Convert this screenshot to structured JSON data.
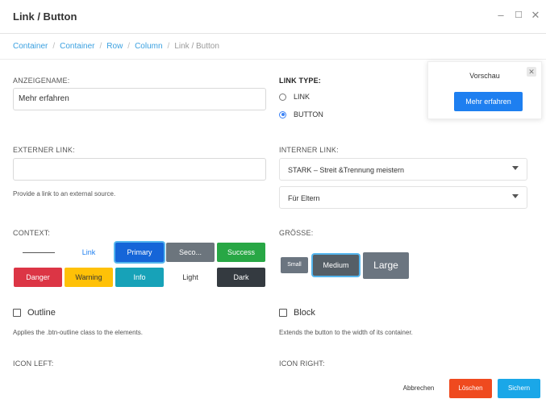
{
  "window": {
    "title": "Link / Button",
    "minimize": "–",
    "maximize": "☐",
    "close": "✕"
  },
  "breadcrumb": [
    {
      "label": "Container"
    },
    {
      "label": "Container"
    },
    {
      "label": "Row"
    },
    {
      "label": "Column"
    },
    {
      "label": "Link / Button"
    }
  ],
  "breadcrumb_sep": "/",
  "fields": {
    "anzeigename_label": "ANZEIGENAME:",
    "anzeigename_value": "Mehr erfahren",
    "linktype_label": "LINK TYPE:",
    "linktype_options": [
      "LINK",
      "BUTTON"
    ],
    "linktype_selected": "BUTTON",
    "extern_label": "EXTERNER LINK:",
    "extern_value": "",
    "extern_help": "Provide a link to an external source.",
    "intern_label": "INTERNER LINK:",
    "intern_select1": "STARK – Streit &Trennung meistern",
    "intern_select2": "Für Eltern",
    "context_label": "CONTEXT:",
    "size_label": "GRÖSSE:",
    "outline_label": "Outline",
    "outline_help": "Applies the .btn-outline class to the elements.",
    "block_label": "Block",
    "block_help": "Extends the button to the width of its container.",
    "icon_left_label": "ICON LEFT:",
    "icon_right_label": "ICON RIGHT:"
  },
  "preview": {
    "title": "Vorschau",
    "close": "✕",
    "button": "Mehr erfahren"
  },
  "context_buttons": {
    "link": "Link",
    "primary": "Primary",
    "secondary": "Seco...",
    "success": "Success",
    "danger": "Danger",
    "warning": "Warning",
    "info": "Info",
    "light": "Light",
    "dark": "Dark"
  },
  "size_buttons": {
    "small": "Small",
    "medium": "Medium",
    "large": "Large"
  },
  "footer": {
    "cancel": "Abbrechen",
    "delete": "Löschen",
    "save": "Sichern"
  },
  "colors": {
    "primary": "#1565d8",
    "secondary": "#6c757d",
    "success": "#28a745",
    "danger": "#dc3545",
    "warning": "#ffc107",
    "info": "#17a2b8",
    "dark": "#343a40",
    "delete": "#ef4a1f",
    "save": "#1aa7e8",
    "link": "#1e7ff0"
  }
}
